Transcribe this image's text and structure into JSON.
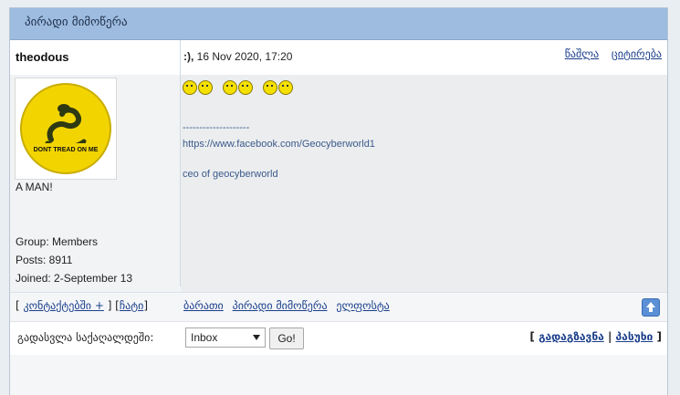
{
  "topic": {
    "title": "პირადი მიმოწერა"
  },
  "post": {
    "author": "theodous",
    "date_prefix": ":),",
    "date": "16 Nov 2020, 17:20",
    "delete_label": "წაშლა",
    "quote_label": "ციტირება",
    "avatar_text": "DONT TREAD ON ME",
    "profile": {
      "title": "A MAN!",
      "group": "Group: Members",
      "posts": "Posts: 8911",
      "joined": "Joined: 2-September 13"
    },
    "signature": {
      "divider": "--------------------",
      "link": "https://www.facebook.com/Geocyberworld1",
      "tagline": "ceo of geocyberworld"
    }
  },
  "actions": {
    "contacts": "კონტაქტებში +",
    "chat": "ჩატი",
    "block": "ბარათი",
    "pm": "პირადი მიმოწერა",
    "email": "ელფოსტა"
  },
  "footer": {
    "jump_label": "გადასვლა საქაღალდეში:",
    "folder_selected": "Inbox",
    "go_label": "Go!",
    "forward_label": "გადაგზავნა",
    "reply_label": "პასუხი"
  },
  "colors": {
    "titlebar": "#9dbce0",
    "link": "#1a3e8a",
    "signature": "#3c5a8a"
  }
}
